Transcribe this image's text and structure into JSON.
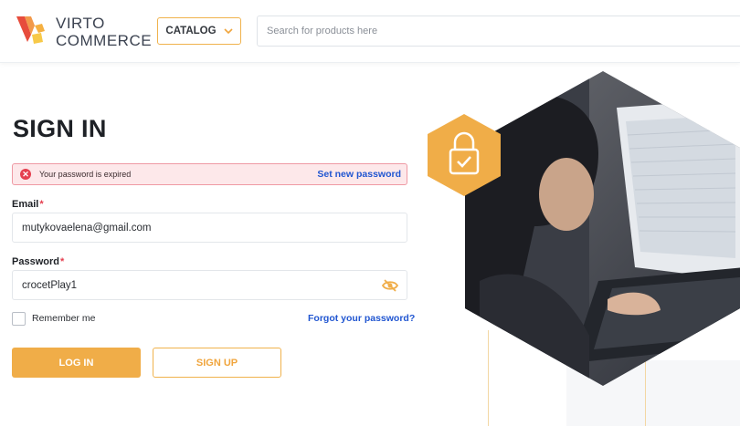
{
  "header": {
    "logo": {
      "line1": "VIRTO",
      "line2": "COMMERCE"
    },
    "catalog_label": "CATALOG",
    "search_placeholder": "Search for products here"
  },
  "signin": {
    "title": "SIGN IN",
    "alert": {
      "message": "Your password is expired",
      "link": "Set new password"
    },
    "email": {
      "label": "Email",
      "required_mark": "*",
      "value": "mutykovaelena@gmail.com"
    },
    "password": {
      "label": "Password",
      "required_mark": "*",
      "value": "crocetPlay1"
    },
    "remember_label": "Remember me",
    "forgot_label": "Forgot your password?",
    "login_label": "LOG IN",
    "signup_label": "SIGN UP"
  },
  "icons": {
    "catalog_chevron": "chevron-down-icon",
    "alert": "error-icon",
    "password_toggle": "eye-slash-icon",
    "lock_badge": "lock-check-icon"
  },
  "colors": {
    "accent": "#f0ad48",
    "link": "#2156d1",
    "error": "#e53f4f",
    "error_bg": "#fde8ea"
  }
}
